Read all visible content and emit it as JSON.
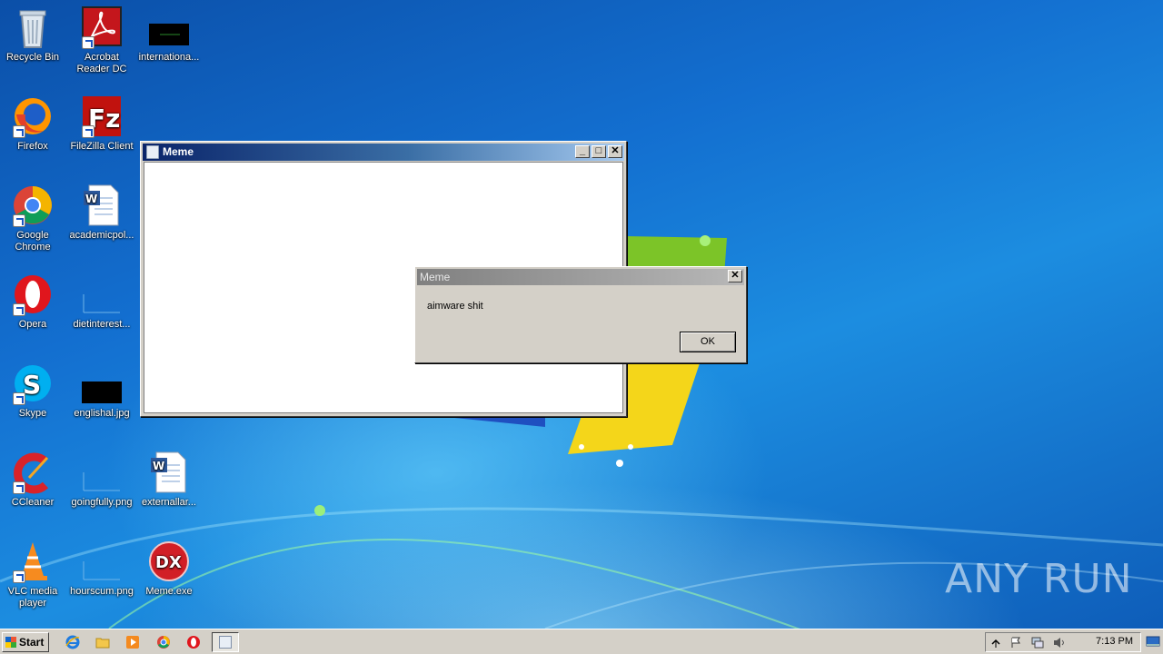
{
  "desktop": {
    "icons": [
      {
        "label": "Recycle Bin"
      },
      {
        "label": "Acrobat Reader DC"
      },
      {
        "label": "internationa..."
      },
      {
        "label": "Firefox"
      },
      {
        "label": "FileZilla Client"
      },
      {
        "label": "Google Chrome"
      },
      {
        "label": "academicpol..."
      },
      {
        "label": "Opera"
      },
      {
        "label": "dietinterest..."
      },
      {
        "label": "Skype"
      },
      {
        "label": "englishal.jpg"
      },
      {
        "label": "CCleaner"
      },
      {
        "label": "goingfully.png"
      },
      {
        "label": "externallar..."
      },
      {
        "label": "VLC media player"
      },
      {
        "label": "hourscum.png"
      },
      {
        "label": "Meme.exe"
      }
    ]
  },
  "main_window": {
    "title": "Meme",
    "minimize_label": "_",
    "maximize_label": "□",
    "close_label": "✕"
  },
  "dialog": {
    "title": "Meme",
    "message": "aimware shit",
    "ok_label": "OK",
    "close_label": "✕"
  },
  "taskbar": {
    "start_label": "Start",
    "clock": "7:13 PM"
  },
  "watermark": {
    "text": "ANY RUN"
  }
}
